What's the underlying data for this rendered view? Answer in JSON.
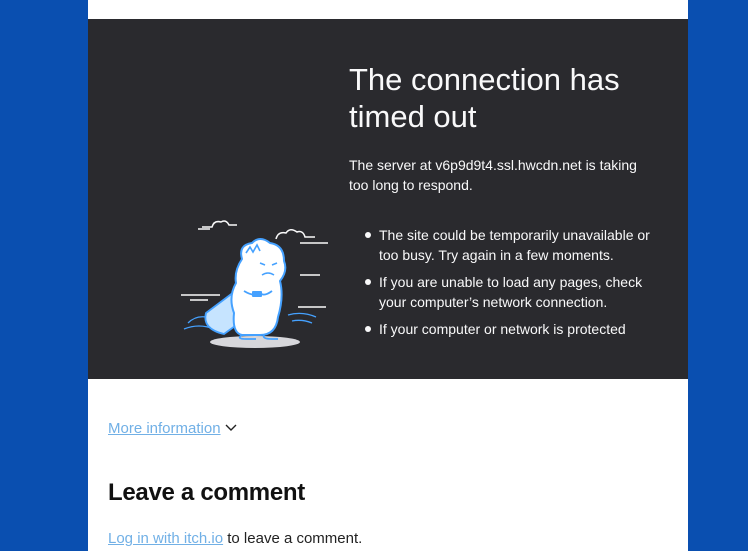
{
  "error_frame": {
    "title": "The connection has timed out",
    "description": "The server at v6p9d9t4.ssl.hwcdn.net is taking too long to respond.",
    "suggestions": [
      "The site could be temporarily unavailable or too busy. Try again in a few moments.",
      "If you are unable to load any pages, check your computer’s network connection.",
      "If your computer or network is protected"
    ],
    "illustration_icon": "timeout-dinosaur-icon"
  },
  "more_information": {
    "label": "More information",
    "icon": "chevron-down-icon"
  },
  "comments": {
    "heading": "Leave a comment",
    "login_link": "Log in with itch.io",
    "login_suffix": " to leave a comment."
  },
  "colors": {
    "outer_background": "#0a4fb0",
    "error_background": "#2a2a2e",
    "error_text": "#f9f9fa",
    "link": "#71b0e6",
    "dinosaur_outline": "#45a1ff"
  }
}
